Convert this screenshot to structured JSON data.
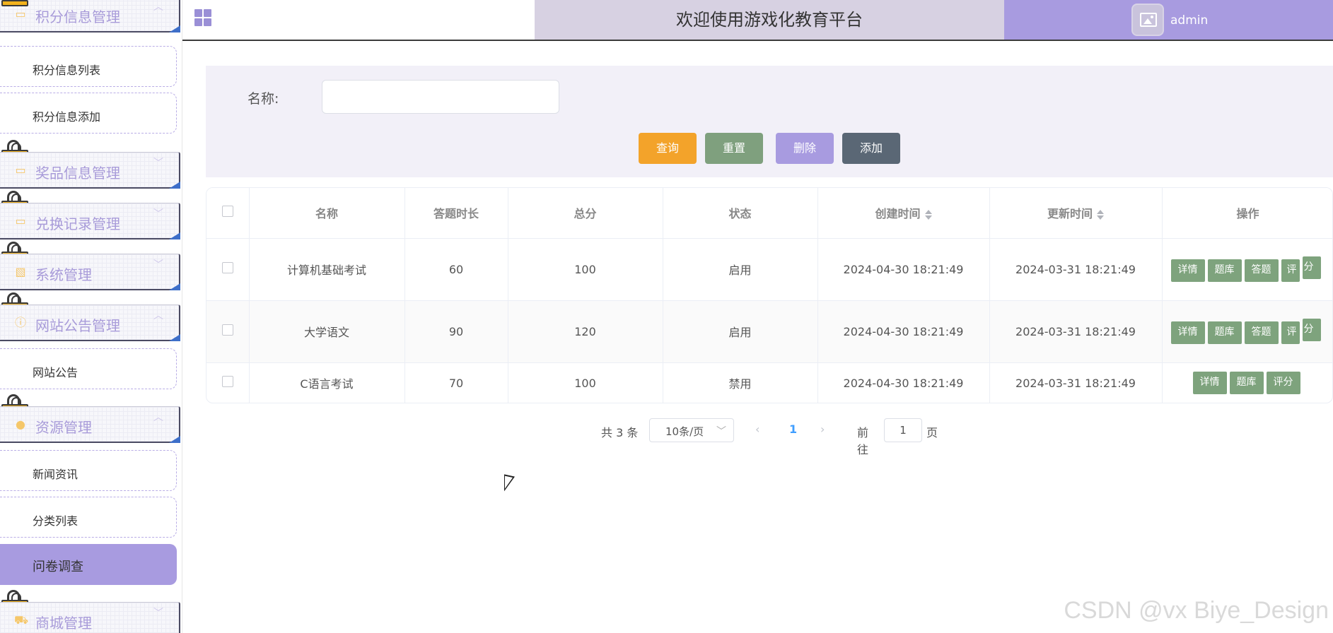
{
  "sidebar": {
    "groups": [
      {
        "label": "积分信息管理",
        "icon": "document-icon",
        "arrow": "︿"
      },
      {
        "label": "奖品信息管理",
        "icon": "document-icon",
        "arrow": "﹀"
      },
      {
        "label": "兑换记录管理",
        "icon": "document-icon",
        "arrow": "﹀"
      },
      {
        "label": "系统管理",
        "icon": "image-icon",
        "arrow": "﹀"
      },
      {
        "label": "网站公告管理",
        "icon": "info-icon",
        "arrow": "︿"
      },
      {
        "label": "资源管理",
        "icon": "bulb-icon",
        "arrow": "︿"
      },
      {
        "label": "商城管理",
        "icon": "cart-icon",
        "arrow": "﹀"
      }
    ],
    "items": [
      {
        "label": "积分信息列表"
      },
      {
        "label": "积分信息添加"
      },
      {
        "label": "网站公告"
      },
      {
        "label": "新闻资讯"
      },
      {
        "label": "分类列表"
      },
      {
        "label": "问卷调查"
      }
    ]
  },
  "header": {
    "title": "欢迎使用游戏化教育平台",
    "user": "admin"
  },
  "search": {
    "name_label": "名称:",
    "name_value": "",
    "buttons": {
      "query": "查询",
      "reset": "重置",
      "delete": "删除",
      "add": "添加"
    }
  },
  "table": {
    "columns": [
      "名称",
      "答题时长",
      "总分",
      "状态",
      "创建时间",
      "更新时间",
      "操作"
    ],
    "rows": [
      {
        "name": "计算机基础考试",
        "duration": "60",
        "score": "100",
        "status": "启用",
        "created": "2024-04-30 18:21:49",
        "updated": "2024-03-31 18:21:49",
        "actions": [
          "详情",
          "题库",
          "答题",
          "评",
          "分"
        ]
      },
      {
        "name": "大学语文",
        "duration": "90",
        "score": "120",
        "status": "启用",
        "created": "2024-04-30 18:21:49",
        "updated": "2024-03-31 18:21:49",
        "actions": [
          "详情",
          "题库",
          "答题",
          "评",
          "分"
        ]
      },
      {
        "name": "C语言考试",
        "duration": "70",
        "score": "100",
        "status": "禁用",
        "created": "2024-04-30 18:21:49",
        "updated": "2024-03-31 18:21:49",
        "actions": [
          "详情",
          "题库",
          "评分"
        ]
      }
    ]
  },
  "pagination": {
    "total": "共 3 条",
    "page_size": "10条/页",
    "current": "1",
    "goto_label": "前往",
    "goto_value": "1",
    "page_unit": "页"
  },
  "watermark": "CSDN @vx Biye_Design",
  "colors": {
    "accent": "#a89be0",
    "query": "#f3a32a",
    "reset": "#7fa07e",
    "add": "#5a6775",
    "action": "#7ea37d"
  }
}
